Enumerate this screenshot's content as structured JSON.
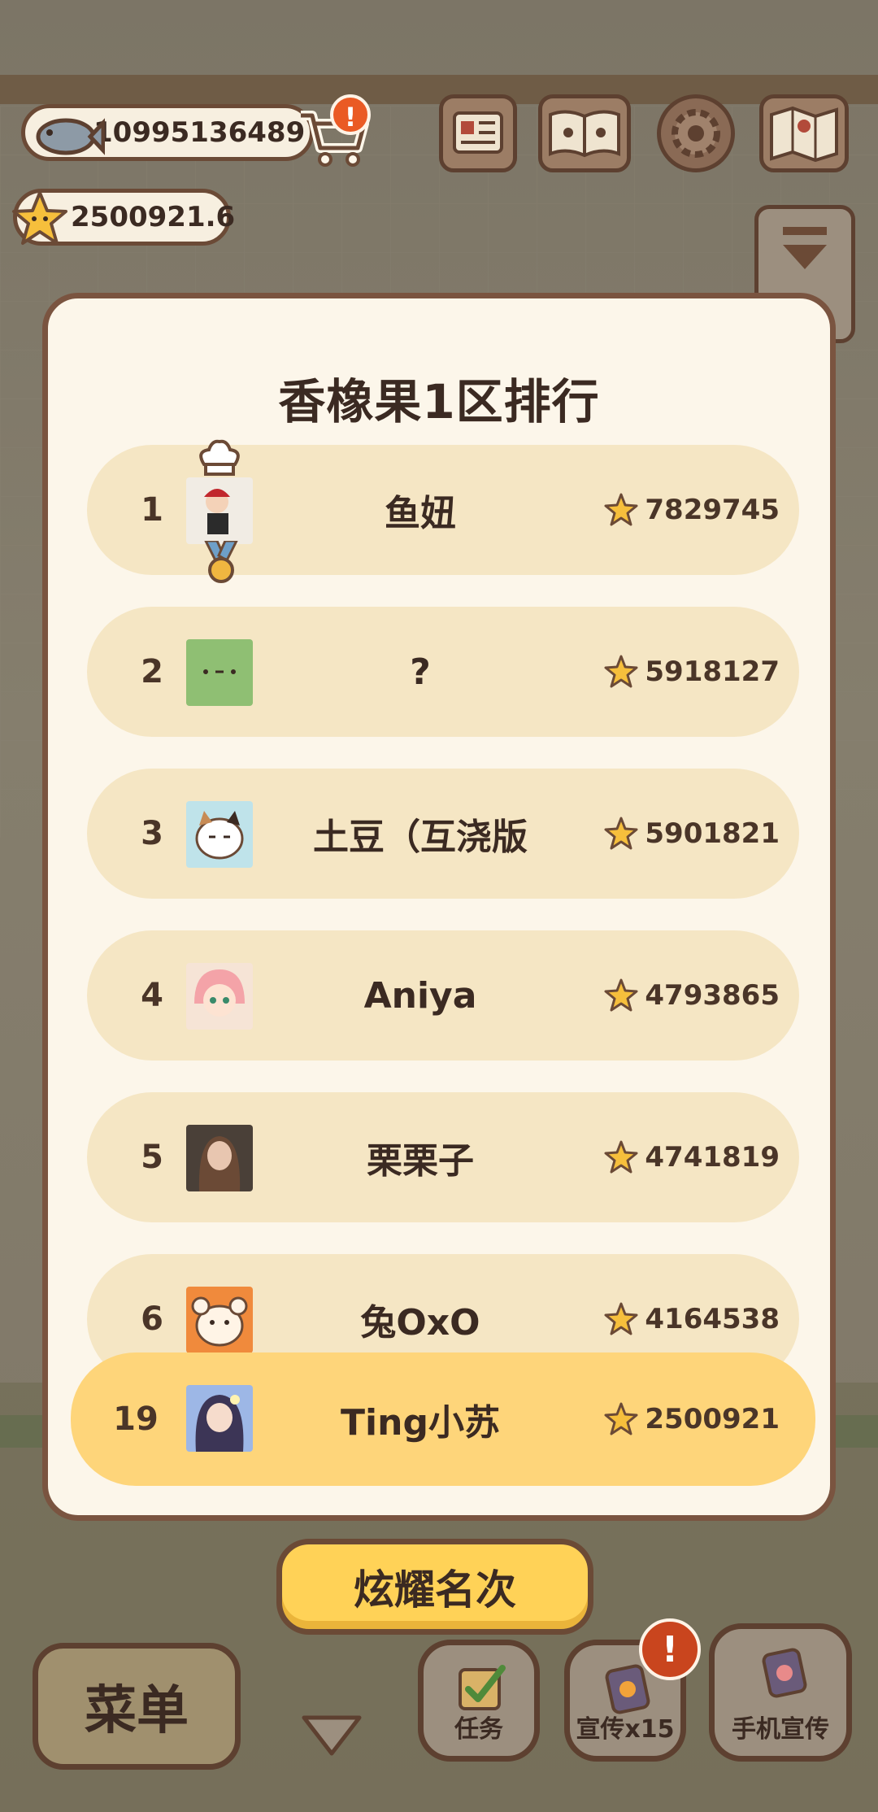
{
  "hud": {
    "fish_count": "10995136489",
    "star_count": "2500921.6",
    "cart_badge": "!",
    "icons": [
      "fish-icon",
      "cart-icon",
      "newspaper-icon",
      "recipe-book-icon",
      "settings-gear-icon",
      "map-icon"
    ]
  },
  "leaderboard": {
    "title": "香橡果1区排行",
    "rows": [
      {
        "rank": "1",
        "name": "鱼妞",
        "score": "7829745",
        "avatar": "chef-girl-avatar"
      },
      {
        "rank": "2",
        "name": "?",
        "score": "5918127",
        "avatar": "green-face-avatar"
      },
      {
        "rank": "3",
        "name": "土豆（互浇版",
        "score": "5901821",
        "avatar": "cat-avatar"
      },
      {
        "rank": "4",
        "name": "Aniya",
        "score": "4793865",
        "avatar": "anime-girl-avatar"
      },
      {
        "rank": "5",
        "name": "栗栗子",
        "score": "4741819",
        "avatar": "portrait-avatar"
      },
      {
        "rank": "6",
        "name": "兔OxO",
        "score": "4164538",
        "avatar": "hamster-avatar"
      }
    ],
    "me": {
      "rank": "19",
      "name": "Ting小苏",
      "score": "2500921",
      "avatar": "my-avatar"
    }
  },
  "buttons": {
    "show_off": "炫耀名次",
    "menu": "菜单",
    "tasks": "任务",
    "promote": "宣传x15",
    "phone_promote": "手机宣传",
    "promote_badge": "!"
  },
  "colors": {
    "row_bg": "#f5e6c4",
    "me_row_bg": "#fed57a",
    "modal_bg": "#fcf6ea",
    "border": "#7a5440",
    "badge": "#ea5a24"
  }
}
